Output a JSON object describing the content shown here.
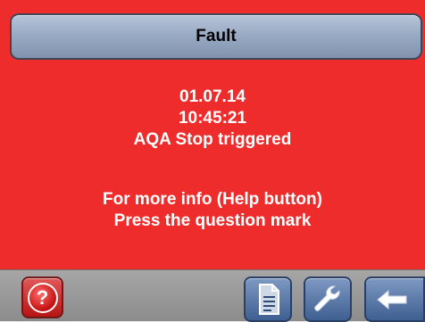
{
  "header": {
    "title": "Fault"
  },
  "message": {
    "date": "01.07.14",
    "time": "10:45:21",
    "event": "AQA Stop triggered",
    "info_line1": "For more info (Help button)",
    "info_line2": "Press the question mark"
  },
  "toolbar": {
    "help_glyph": "?",
    "buttons": [
      "question-mark-icon",
      "document-icon",
      "wrench-icon",
      "back-arrow-icon"
    ]
  },
  "colors": {
    "fault_background": "#ee2c2c",
    "title_bar": "#9aabc4",
    "toolbar": "#999999",
    "button_blue": "#4f6fa2"
  }
}
